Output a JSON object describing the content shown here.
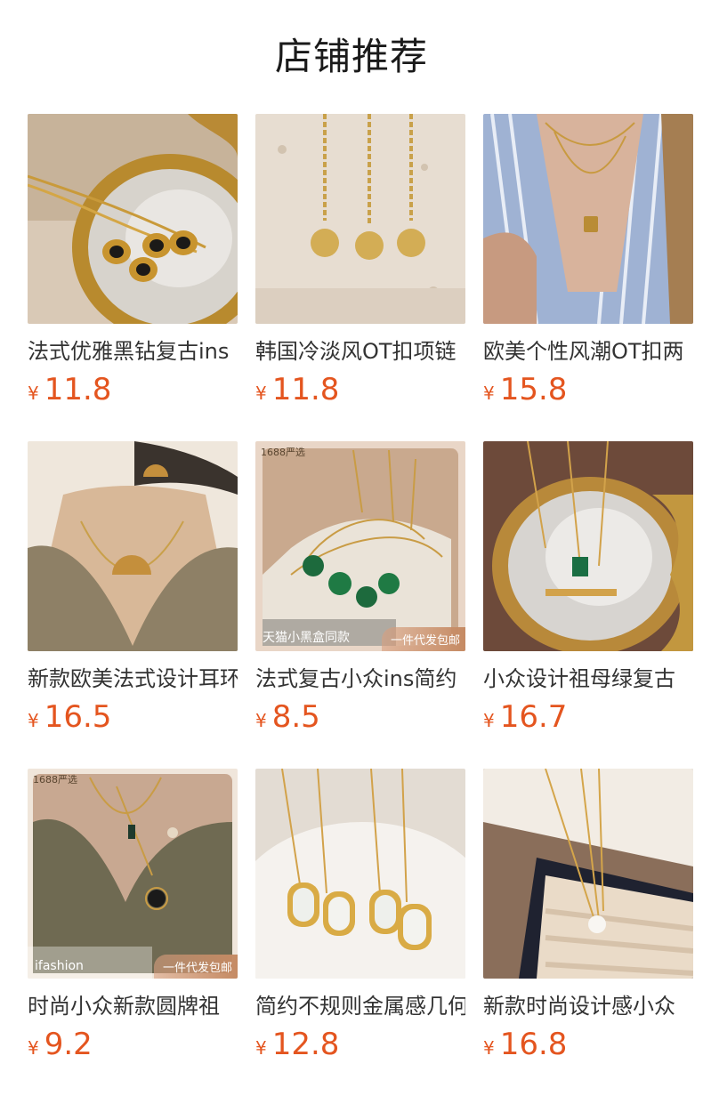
{
  "section_title": "店铺推荐",
  "currency": "¥",
  "products": [
    {
      "name": "法式优雅黑钻复古ins",
      "price": "11.8",
      "image": "gold-pendant-mirror"
    },
    {
      "name": "韩国冷淡风OT扣项链",
      "price": "11.8",
      "image": "gold-coin-necklaces-stone"
    },
    {
      "name": "欧美个性风潮OT扣两",
      "price": "15.8",
      "image": "lock-necklace-striped-shirt"
    },
    {
      "name": "新款欧美法式设计耳环",
      "price": "16.5",
      "image": "fan-pendant-model"
    },
    {
      "name": "法式复古小众ins简约",
      "price": "8.5",
      "image": "green-stone-bracelets",
      "badges": {
        "top": "1688严选",
        "left": "天猫小黑盒同款",
        "right": "一件代发包邮"
      }
    },
    {
      "name": "小众设计祖母绿复古",
      "price": "16.7",
      "image": "emerald-necklace-mirror"
    },
    {
      "name": "时尚小众新款圆牌祖",
      "price": "9.2",
      "image": "round-pendant-model",
      "badges": {
        "top": "1688严选",
        "left": "ifashion",
        "right": "一件代发包邮"
      }
    },
    {
      "name": "简约不规则金属感几何",
      "price": "12.8",
      "image": "shell-pendants-dish"
    },
    {
      "name": "新款时尚设计感小众",
      "price": "16.8",
      "image": "pearl-necklace-jewelry-box"
    }
  ]
}
